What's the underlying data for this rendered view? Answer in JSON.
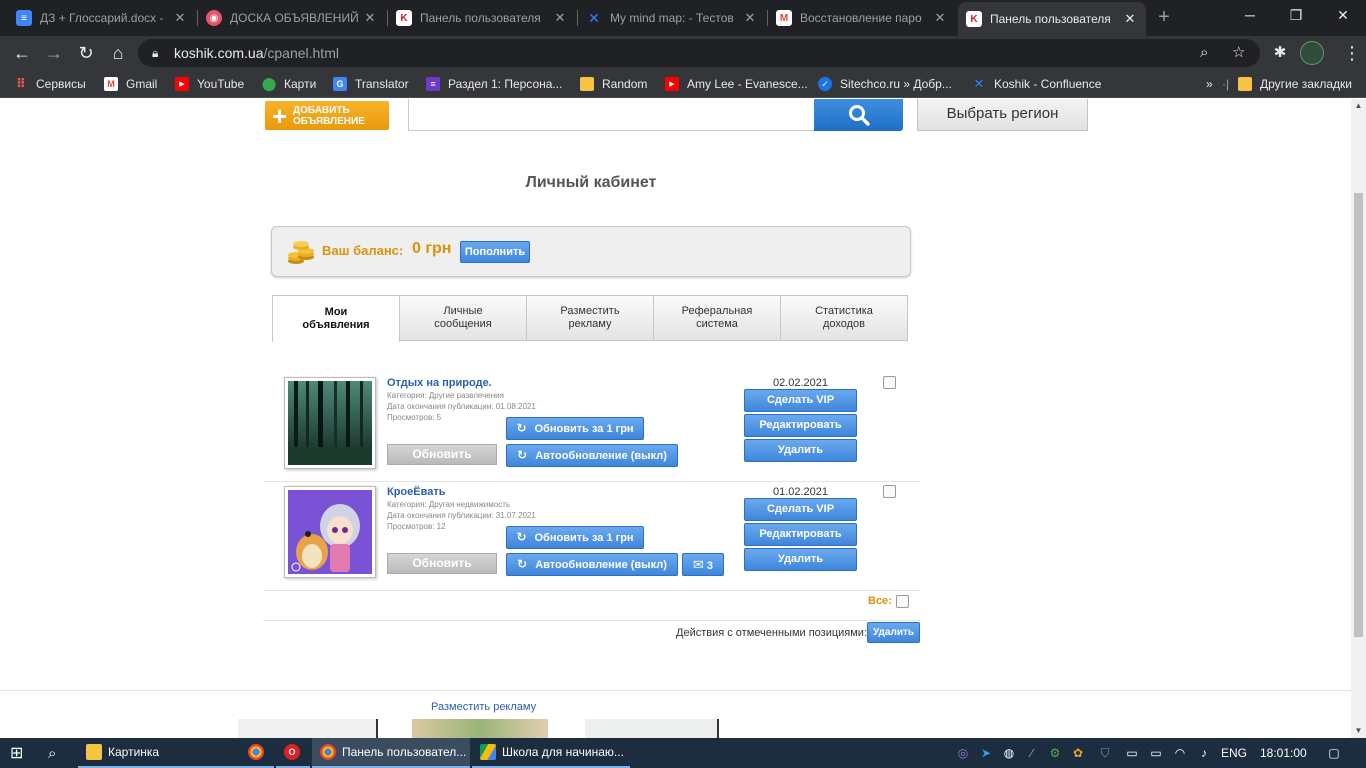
{
  "browser": {
    "tabs": [
      {
        "title": "ДЗ + Глоссарий.docx -",
        "favicon": "google-docs-icon",
        "color": "#4285f4"
      },
      {
        "title": "ДОСКА ОБЪЯВЛЕНИЙ",
        "favicon": "board-icon",
        "color": "#e8546b"
      },
      {
        "title": "Панель пользователя",
        "favicon": "koshik-icon",
        "color": "#d11f2c"
      },
      {
        "title": "My mind map: - Тестов",
        "favicon": "confluence-icon",
        "color": "#2684ff"
      },
      {
        "title": "Восстановление паро",
        "favicon": "gmail-icon",
        "color": "#ea4335"
      },
      {
        "title": "Панель пользователя",
        "favicon": "koshik-icon",
        "color": "#d11f2c"
      }
    ],
    "active_tab": 5,
    "url_host": "koshik.com.ua",
    "url_path": "/cpanel.html",
    "bookmarks": [
      {
        "label": "Сервисы",
        "icon": "apps-grid-icon"
      },
      {
        "label": "Gmail",
        "icon": "gmail-icon"
      },
      {
        "label": "YouTube",
        "icon": "youtube-icon"
      },
      {
        "label": "Карти",
        "icon": "maps-icon"
      },
      {
        "label": "Translator",
        "icon": "translate-icon"
      },
      {
        "label": "Раздел 1: Персона...",
        "icon": "course-icon"
      },
      {
        "label": "Random",
        "icon": "folder-icon"
      },
      {
        "label": "Amy Lee - Evanesce...",
        "icon": "youtube-icon"
      },
      {
        "label": "Sitechco.ru » Добр...",
        "icon": "check-icon"
      },
      {
        "label": "Koshik - Confluence",
        "icon": "confluence-icon"
      }
    ],
    "other_bookmarks": "Другие закладки"
  },
  "header": {
    "add_ad_line1": "Добавить",
    "add_ad_line2": "объявление",
    "region_button": "Выбрать регион"
  },
  "page": {
    "title": "Личный кабинет",
    "balance_label": "Ваш баланс:",
    "balance_value": "0 грн",
    "topup_button": "Пополнить",
    "tabs": [
      {
        "line1": "Мои",
        "line2": "объявления"
      },
      {
        "line1": "Личные",
        "line2": "сообщения"
      },
      {
        "line1": "Разместить",
        "line2": "рекламу"
      },
      {
        "line1": "Реферальная",
        "line2": "система"
      },
      {
        "line1": "Статистика",
        "line2": "доходов"
      }
    ],
    "active_tab": 0
  },
  "ads": [
    {
      "title": "Отдых на природе.",
      "category": "Категория: Другие развлечения",
      "expires": "Дата окончания публикации: 01.08.2021",
      "views": "Просмотров: 5",
      "date": "02.02.2021",
      "refresh_button": "Обновить",
      "paid_refresh_button": "Обновить за 1 грн",
      "autorefresh_button": "Автообновление (выкл)",
      "vip_button": "Сделать VIP",
      "edit_button": "Редактировать",
      "delete_button": "Удалить"
    },
    {
      "title": "КроеЁвать",
      "category": "Категория: Другая недвижимость",
      "expires": "Дата окончания публикации: 31.07.2021",
      "views": "Просмотров: 12",
      "date": "01.02.2021",
      "refresh_button": "Обновить",
      "paid_refresh_button": "Обновить за 1 грн",
      "autorefresh_button": "Автообновление (выкл)",
      "messages_count": "3",
      "vip_button": "Сделать VIP",
      "edit_button": "Редактировать",
      "delete_button": "Удалить"
    }
  ],
  "bulk": {
    "all_label": "Все:",
    "actions_label": "Действия с отмеченными позициями:",
    "delete_button": "Удалить"
  },
  "footer": {
    "place_ad_link": "Разместить рекламу"
  },
  "taskbar": {
    "items": [
      {
        "label": "Картинка",
        "icon": "folder-icon"
      },
      {
        "label": "",
        "icon": "chrome-icon"
      },
      {
        "label": "",
        "icon": "opera-icon"
      },
      {
        "label": "Панель пользовател...",
        "icon": "chrome-icon"
      },
      {
        "label": "Школа для начинаю...",
        "icon": "google-drive-icon"
      }
    ],
    "language": "ENG",
    "time": "18:01:00"
  },
  "colors": {
    "accent_blue": "#3f86dc",
    "accent_orange": "#e99a0c",
    "title_blue": "#2a5fae"
  }
}
